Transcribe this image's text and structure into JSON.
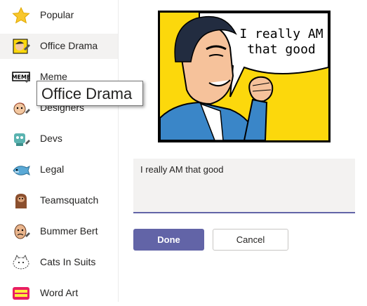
{
  "sidebar": {
    "items": [
      {
        "label": "Popular",
        "icon": "star-icon"
      },
      {
        "label": "Office Drama",
        "icon": "office-drama-icon"
      },
      {
        "label": "Meme",
        "icon": "meme-icon"
      },
      {
        "label": "Designers",
        "icon": "designers-icon"
      },
      {
        "label": "Devs",
        "icon": "devs-icon"
      },
      {
        "label": "Legal",
        "icon": "legal-icon"
      },
      {
        "label": "Teamsquatch",
        "icon": "teamsquatch-icon"
      },
      {
        "label": "Bummer Bert",
        "icon": "bummer-bert-icon"
      },
      {
        "label": "Cats In Suits",
        "icon": "cats-in-suits-icon"
      },
      {
        "label": "Word Art",
        "icon": "word-art-icon"
      }
    ],
    "selected": "Office Drama"
  },
  "tooltip": {
    "text": "Office Drama"
  },
  "meme": {
    "caption": "I really AM\nthat good"
  },
  "editor": {
    "text": "I really AM that good"
  },
  "actions": {
    "done_label": "Done",
    "cancel_label": "Cancel"
  },
  "colors": {
    "accent": "#6264a7",
    "selected_bg": "#f3f2f1",
    "meme_bg": "#fcd80c"
  }
}
